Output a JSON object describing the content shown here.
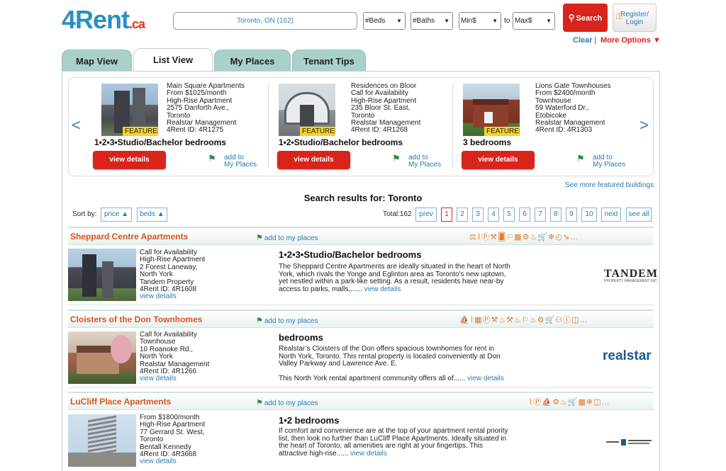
{
  "header": {
    "logo_main": "4Rent",
    "logo_suffix": ".ca",
    "location_value": "Toronto, ON (162)",
    "beds_select": "#Beds",
    "baths_select": "#Baths",
    "min_select": "Min$",
    "to_label": "to",
    "max_select": "Max$",
    "search_label": "Search",
    "register_line1": "Register/",
    "register_line2": "Login",
    "clear_label": "Clear",
    "separator": "|",
    "more_options_label": "More Options ▼"
  },
  "tabs": [
    {
      "label": "Map View",
      "active": false
    },
    {
      "label": "List View",
      "active": true
    },
    {
      "label": "My Places",
      "active": false
    },
    {
      "label": "Tenant Tips",
      "active": false
    }
  ],
  "featured": {
    "prev_arrow": "<",
    "next_arrow": ">",
    "badge": "FEATURED",
    "view_details": "view details",
    "add_line1": "add to",
    "add_line2": "My Places",
    "items": [
      {
        "lines": [
          "Main Square Apartments",
          "From $1025/month",
          "High-Rise Apartment",
          "2575 Danforth Ave.,",
          "Toronto",
          "Realstar Management",
          "4Rent ID: 4R1275"
        ],
        "beds": "1•2•3•Studio/Bachelor bedrooms"
      },
      {
        "lines": [
          "Residences on Bloor",
          "Call for Availability",
          "High-Rise Apartment",
          "235 Bloor St. East,",
          "Toronto",
          "Realstar Management",
          "4Rent ID: 4R1268"
        ],
        "beds": "1•2•Studio/Bachelor bedrooms"
      },
      {
        "lines": [
          "Lions Gate Townhouses",
          "From $2400/month",
          "Townhouse",
          "59 Waterford Dr.,",
          "Etobicoke",
          "Realstar Management",
          "4Rent ID: 4R1303"
        ],
        "beds": "3 bedrooms"
      }
    ],
    "see_more": "See more featured buildings"
  },
  "results": {
    "title": "Search results for: Toronto",
    "sort_label": "Sort by:",
    "sort_price": "price ▲",
    "sort_beds": "beds ▲",
    "total": "Total:162",
    "pages": [
      "prev",
      "1",
      "2",
      "3",
      "4",
      "5",
      "6",
      "7",
      "8",
      "9",
      "10",
      "next",
      "see all"
    ],
    "current_page": "1"
  },
  "listings": [
    {
      "name": "Sheppard Centre Apartments",
      "add_label": "add to my places",
      "amenities": "⚖⌇Ⓟ⚒🂠⚐▦⚙♨🛒❄◴⇘…",
      "lines": [
        "Call for Availability",
        "High-Rise Apartment",
        "2 Forest Laneway,",
        "North York",
        "Tandem Property",
        "4Rent ID: 4R1608"
      ],
      "view_details": "view details",
      "beds": "1•2•3•Studio/Bachelor bedrooms",
      "desc": "The Sheppard Centre Apartments are ideally situated in the heart of North York, which rivals the Yonge and Eglinton area as Toronto's new uptown, yet nestled within a park-like setting. As a result, residents have near-by access to parks, malls,......",
      "desc2": "",
      "desc_link": "view details",
      "logo_text": "TANDEM",
      "logo_sub": "PROPERTY MANAGEMENT INC."
    },
    {
      "name": "Cloisters of the Don Townhomes",
      "add_label": "add to my places",
      "amenities": "⛵⌇▦Ⓟ⚒♨⚒♨⚐♨⚙🛒⚇Ⓘ◫…",
      "lines": [
        "Call for Availability",
        "Townhouse",
        "10 Roanoke Rd.,",
        "North York",
        "Realstar Management",
        "4Rent ID: 4R1266"
      ],
      "view_details": "view details",
      "beds": "bedrooms",
      "desc": "Realstar’s Cloisters of the Don offers spacious townhomes for rent in North York, Toronto. This rental property is located conveniently at Don Valley Parkway and Lawrence Ave. E.",
      "desc2": "This North York rental apartment community offers all of......",
      "desc_link": "view details",
      "logo_text": "realstar",
      "logo_sub": ""
    },
    {
      "name": "LuCliff Place Apartments",
      "add_label": "add to my places",
      "amenities": "⌇Ⓟ⛵⚙♨🛒▦❄◫…",
      "lines": [
        "From $1800/month",
        "High-Rise Apartment",
        "77 Gerrard St. West,",
        "Toronto",
        "Bentall Kennedy",
        "4Rent ID: 4R3668"
      ],
      "view_details": "view details",
      "beds": "1•2 bedrooms",
      "desc": "If comfort and convenience are at the top of your apartment rental priority list, then look no further than LuCliff Place Apartments. Ideally situated in the heart of Toronto, all amenities are right at your fingertips. This attractive high-rise......",
      "desc2": "",
      "desc_link": "view details",
      "logo_text": "",
      "logo_sub": ""
    }
  ],
  "colors": {
    "brand_red": "#d9241c",
    "brand_blue": "#2a8fc6",
    "tab_green": "#a9d1c9",
    "listing_title": "#d9541c",
    "link": "#2a7ab0"
  }
}
